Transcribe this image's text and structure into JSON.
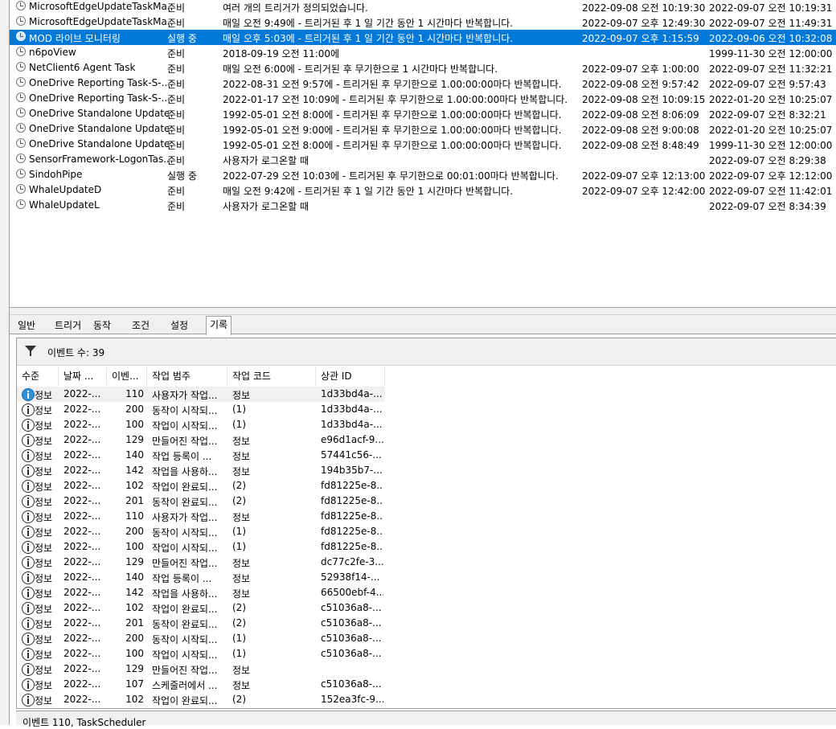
{
  "tasks": [
    {
      "name": "MicrosoftEdgeUpdateTaskMa...",
      "status": "준비",
      "trigger": "여러 개의 트리거가 정의되었습니다.",
      "next_run": "2022-09-08 오전 10:19:30",
      "last_run": "2022-09-07 오전 10:19:31",
      "selected": false
    },
    {
      "name": "MicrosoftEdgeUpdateTaskMa...",
      "status": "준비",
      "trigger": "매일 오전 9:49에 - 트리거된 후 1 일 기간 동안 1 시간마다 반복합니다.",
      "next_run": "2022-09-07 오후 12:49:30",
      "last_run": "2022-09-07 오전 11:49:31",
      "selected": false
    },
    {
      "name": "MOD 라이브 모니터링",
      "status": "실행 중",
      "trigger": "매일 오후 5:03에 - 트리거된 후 1 일 기간 동안 1 시간마다 반복합니다.",
      "next_run": "2022-09-07 오후 1:15:59",
      "last_run": "2022-09-06 오전 10:32:08",
      "selected": true
    },
    {
      "name": "n6poView",
      "status": "준비",
      "trigger": "2018-09-19 오전 11:00에",
      "next_run": "",
      "last_run": "1999-11-30 오전 12:00:00",
      "selected": false
    },
    {
      "name": "NetClient6 Agent Task",
      "status": "준비",
      "trigger": "매일 오전 6:00에 - 트리거된 후 무기한으로 1 시간마다 반복합니다.",
      "next_run": "2022-09-07 오후 1:00:00",
      "last_run": "2022-09-07 오전 11:32:21",
      "selected": false
    },
    {
      "name": "OneDrive Reporting Task-S-...",
      "status": "준비",
      "trigger": "2022-08-31 오전 9:57에 - 트리거된 후 무기한으로 1.00:00:00마다 반복합니다.",
      "next_run": "2022-09-08 오전 9:57:42",
      "last_run": "2022-09-07 오전 9:57:43",
      "selected": false
    },
    {
      "name": "OneDrive Reporting Task-S-...",
      "status": "준비",
      "trigger": "2022-01-17 오전 10:09에 - 트리거된 후 무기한으로 1.00:00:00마다 반복합니다.",
      "next_run": "2022-09-08 오전 10:09:15",
      "last_run": "2022-01-20 오전 10:25:07",
      "selected": false
    },
    {
      "name": "OneDrive Standalone Update...",
      "status": "준비",
      "trigger": "1992-05-01 오전 8:00에 - 트리거된 후 무기한으로 1.00:00:00마다 반복합니다.",
      "next_run": "2022-09-08 오전 8:06:09",
      "last_run": "2022-09-07 오전 8:32:21",
      "selected": false
    },
    {
      "name": "OneDrive Standalone Update...",
      "status": "준비",
      "trigger": "1992-05-01 오전 9:00에 - 트리거된 후 무기한으로 1.00:00:00마다 반복합니다.",
      "next_run": "2022-09-08 오전 9:00:08",
      "last_run": "2022-01-20 오전 10:25:07",
      "selected": false
    },
    {
      "name": "OneDrive Standalone Update...",
      "status": "준비",
      "trigger": "1992-05-01 오전 8:00에 - 트리거된 후 무기한으로 1.00:00:00마다 반복합니다.",
      "next_run": "2022-09-08 오전 8:48:49",
      "last_run": "1999-11-30 오전 12:00:00",
      "selected": false
    },
    {
      "name": "SensorFramework-LogonTas...",
      "status": "준비",
      "trigger": "사용자가 로그온할 때",
      "next_run": "",
      "last_run": "2022-09-07 오전 8:29:38",
      "selected": false
    },
    {
      "name": "SindohPipe",
      "status": "실행 중",
      "trigger": "2022-07-29 오전 10:03에 - 트리거된 후 무기한으로 00:01:00마다 반복합니다.",
      "next_run": "2022-09-07 오후 12:13:00",
      "last_run": "2022-09-07 오후 12:12:00",
      "selected": false
    },
    {
      "name": "WhaleUpdateD",
      "status": "준비",
      "trigger": "매일 오전 9:42에 - 트리거된 후 1 일 기간 동안 1 시간마다 반복합니다.",
      "next_run": "2022-09-07 오후 12:42:00",
      "last_run": "2022-09-07 오전 11:42:01",
      "selected": false
    },
    {
      "name": "WhaleUpdateL",
      "status": "준비",
      "trigger": "사용자가 로그온할 때",
      "next_run": "",
      "last_run": "2022-09-07 오전 8:34:39",
      "selected": false
    }
  ],
  "tabs": [
    "일반",
    "트리거",
    "동작",
    "조건",
    "설정",
    "기록"
  ],
  "history": {
    "event_count_label": "이벤트 수: 39",
    "columns": [
      "수준",
      "날짜 ...",
      "이벤...",
      "작업 범주",
      "작업 코드",
      "상관 ID"
    ],
    "rows": [
      {
        "level": "정보",
        "date": "2022-...",
        "event_id": "110",
        "category": "사용자가 작업...",
        "opcode": "정보",
        "correlation": "1d33bd4a-..."
      },
      {
        "level": "정보",
        "date": "2022-...",
        "event_id": "200",
        "category": "동작이 시작되...",
        "opcode": "(1)",
        "correlation": "1d33bd4a-..."
      },
      {
        "level": "정보",
        "date": "2022-...",
        "event_id": "100",
        "category": "작업이 시작되...",
        "opcode": "(1)",
        "correlation": "1d33bd4a-..."
      },
      {
        "level": "정보",
        "date": "2022-...",
        "event_id": "129",
        "category": "만들어진 작업...",
        "opcode": "정보",
        "correlation": "e96d1acf-9..."
      },
      {
        "level": "정보",
        "date": "2022-...",
        "event_id": "140",
        "category": "작업 등록이 ...",
        "opcode": "정보",
        "correlation": "57441c56-..."
      },
      {
        "level": "정보",
        "date": "2022-...",
        "event_id": "142",
        "category": "작업을 사용하...",
        "opcode": "정보",
        "correlation": "194b35b7-..."
      },
      {
        "level": "정보",
        "date": "2022-...",
        "event_id": "102",
        "category": "작업이 완료되...",
        "opcode": "(2)",
        "correlation": "fd81225e-8..."
      },
      {
        "level": "정보",
        "date": "2022-...",
        "event_id": "201",
        "category": "동작이 완료되...",
        "opcode": "(2)",
        "correlation": "fd81225e-8..."
      },
      {
        "level": "정보",
        "date": "2022-...",
        "event_id": "110",
        "category": "사용자가 작업...",
        "opcode": "정보",
        "correlation": "fd81225e-8..."
      },
      {
        "level": "정보",
        "date": "2022-...",
        "event_id": "200",
        "category": "동작이 시작되...",
        "opcode": "(1)",
        "correlation": "fd81225e-8..."
      },
      {
        "level": "정보",
        "date": "2022-...",
        "event_id": "100",
        "category": "작업이 시작되...",
        "opcode": "(1)",
        "correlation": "fd81225e-8..."
      },
      {
        "level": "정보",
        "date": "2022-...",
        "event_id": "129",
        "category": "만들어진 작업...",
        "opcode": "정보",
        "correlation": "dc77c2fe-3..."
      },
      {
        "level": "정보",
        "date": "2022-...",
        "event_id": "140",
        "category": "작업 등록이 ...",
        "opcode": "정보",
        "correlation": "52938f14-..."
      },
      {
        "level": "정보",
        "date": "2022-...",
        "event_id": "142",
        "category": "작업을 사용하...",
        "opcode": "정보",
        "correlation": "66500ebf-4..."
      },
      {
        "level": "정보",
        "date": "2022-...",
        "event_id": "102",
        "category": "작업이 완료되...",
        "opcode": "(2)",
        "correlation": "c51036a8-..."
      },
      {
        "level": "정보",
        "date": "2022-...",
        "event_id": "201",
        "category": "동작이 완료되...",
        "opcode": "(2)",
        "correlation": "c51036a8-..."
      },
      {
        "level": "정보",
        "date": "2022-...",
        "event_id": "200",
        "category": "동작이 시작되...",
        "opcode": "(1)",
        "correlation": "c51036a8-..."
      },
      {
        "level": "정보",
        "date": "2022-...",
        "event_id": "100",
        "category": "작업이 시작되...",
        "opcode": "(1)",
        "correlation": "c51036a8-..."
      },
      {
        "level": "정보",
        "date": "2022-...",
        "event_id": "129",
        "category": "만들어진 작업...",
        "opcode": "정보",
        "correlation": ""
      },
      {
        "level": "정보",
        "date": "2022-...",
        "event_id": "107",
        "category": "스케줄러에서 ...",
        "opcode": "정보",
        "correlation": "c51036a8-..."
      },
      {
        "level": "정보",
        "date": "2022-...",
        "event_id": "102",
        "category": "작업이 완료되...",
        "opcode": "(2)",
        "correlation": "152ea3fc-9..."
      }
    ]
  },
  "status_text": "이벤트 110, TaskScheduler",
  "colors": {
    "selection": "#0078d7",
    "panel": "#f0f0f0",
    "border": "#a0a0a0"
  },
  "icons": {
    "task": "task-clock-icon",
    "filter": "filter-icon",
    "event": "info-icon"
  }
}
